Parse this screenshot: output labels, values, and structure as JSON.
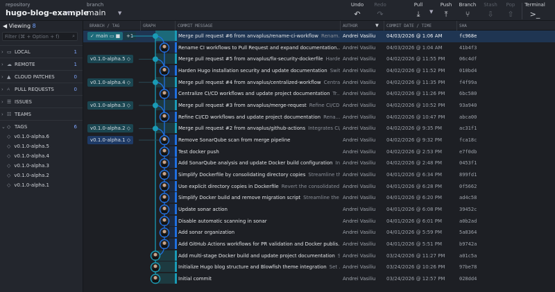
{
  "toolbar": {
    "repo_label": "repository",
    "repo": "hugo-blog-example",
    "branch_label": "branch",
    "branch": "main",
    "buttons": [
      {
        "label": "Undo",
        "icon": "↶"
      },
      {
        "label": "Redo",
        "icon": "↷"
      },
      {
        "label": "Pull",
        "icon": "⤓"
      },
      {
        "label": "Push",
        "icon": "⤒"
      },
      {
        "label": "Branch",
        "icon": "⑂"
      },
      {
        "label": "Stash",
        "icon": "⇩"
      },
      {
        "label": "Pop",
        "icon": "⇧"
      },
      {
        "label": "Terminal",
        "icon": ">_"
      }
    ]
  },
  "sidebar": {
    "viewing_label": "Viewing",
    "viewing_count": "8",
    "filter_placeholder": "Filter (⌘ + Option + f)",
    "sections": [
      {
        "label": "LOCAL",
        "count": "1",
        "icon": "▭"
      },
      {
        "label": "REMOTE",
        "count": "1",
        "icon": "☁"
      },
      {
        "label": "CLOUD PATCHES",
        "count": "0",
        "icon": "▲"
      },
      {
        "label": "PULL REQUESTS",
        "count": "0",
        "icon": "⑃"
      },
      {
        "label": "ISSUES",
        "count": "",
        "icon": "☰"
      },
      {
        "label": "TEAMS",
        "count": "",
        "icon": "☷"
      },
      {
        "label": "TAGS",
        "count": "6",
        "icon": "◇"
      }
    ],
    "tags": [
      "v0.1.0-alpha.6",
      "v0.1.0-alpha.5",
      "v0.1.0-alpha.4",
      "v0.1.0-alpha.3",
      "v0.1.0-alpha.2",
      "v0.1.0-alpha.1"
    ]
  },
  "columns": {
    "branch": "BRANCH / TAG",
    "graph": "GRAPH",
    "message": "COMMIT MESSAGE",
    "author": "AUTHOR",
    "date": "COMMIT DATE / TIME",
    "sha": "SHA"
  },
  "colors": {
    "teal": "#1a9bb5",
    "blue": "#1f6fe0",
    "selected": "#1f3552"
  },
  "commits": [
    {
      "msg": "Merge pull request #6 from anvaplus/rename-ci-workflow",
      "desc": "Renam...",
      "author": "Andrei Vasiliu",
      "date": "04/03/2026 @ 1:06 AM",
      "sha": "fc968e",
      "ref": "main",
      "ref_extra": "+1",
      "lane": "teal",
      "merge": true
    },
    {
      "msg": "Rename CI workflows to Pull Request and expand documentation...",
      "desc": "",
      "author": "Andrei Vasiliu",
      "date": "04/03/2026 @ 1:04 AM",
      "sha": "41b4f3",
      "lane": "blue"
    },
    {
      "msg": "Merge pull request #5 from anvaplus/fix-security-dockerfile",
      "desc": "Harde...",
      "author": "Andrei Vasiliu",
      "date": "04/02/2026 @ 11:55 PM",
      "sha": "06c4df",
      "ref": "v0.1.0-alpha.5",
      "lane": "teal",
      "merge": true
    },
    {
      "msg": "Harden Hugo installation security and update documentation",
      "desc": "Swit...",
      "author": "Andrei Vasiliu",
      "date": "04/02/2026 @ 11:52 PM",
      "sha": "010bd4",
      "lane": "blue"
    },
    {
      "msg": "Merge pull request #4 from anvaplus/centralized-workflow",
      "desc": "Centra...",
      "author": "Andrei Vasiliu",
      "date": "04/02/2026 @ 11:35 PM",
      "sha": "f4f99a",
      "ref": "v0.1.0-alpha.4",
      "lane": "teal",
      "merge": true
    },
    {
      "msg": "Centralize CI/CD workflows and update project documentation",
      "desc": "Tr...",
      "author": "Andrei Vasiliu",
      "date": "04/02/2026 @ 11:26 PM",
      "sha": "6bc580",
      "lane": "blue"
    },
    {
      "msg": "Merge pull request #3 from anvaplus/merge-request",
      "desc": "Refine CI/CD...",
      "author": "Andrei Vasiliu",
      "date": "04/02/2026 @ 10:52 PM",
      "sha": "93a940",
      "ref": "v0.1.0-alpha.3",
      "lane": "teal",
      "merge": true
    },
    {
      "msg": "Refine CI/CD workflows and update project documentation",
      "desc": "Rena...",
      "author": "Andrei Vasiliu",
      "date": "04/02/2026 @ 10:47 PM",
      "sha": "abca00",
      "lane": "blue"
    },
    {
      "msg": "Merge pull request #2 from anvaplus/github-actions",
      "desc": "Integrates CI/...",
      "author": "Andrei Vasiliu",
      "date": "04/02/2026 @ 9:35 PM",
      "sha": "ac31f1",
      "ref": "v0.1.0-alpha.2",
      "lane": "teal",
      "merge": true
    },
    {
      "msg": "Remove SonarQube scan from merge pipeline",
      "desc": "",
      "author": "Andrei Vasiliu",
      "date": "04/02/2026 @ 9:32 PM",
      "sha": "fca18c",
      "ref": "v0.1.0-alpha.1",
      "lane": "blue"
    },
    {
      "msg": "Test docker push",
      "desc": "",
      "author": "Andrei Vasiliu",
      "date": "04/02/2026 @ 2:53 PM",
      "sha": "e7f0db",
      "lane": "blue"
    },
    {
      "msg": "Add SonarQube analysis and update Docker build configuration",
      "desc": "In...",
      "author": "Andrei Vasiliu",
      "date": "04/02/2026 @ 2:48 PM",
      "sha": "0453f1",
      "lane": "blue"
    },
    {
      "msg": "Simplify Dockerfile by consolidating directory copies",
      "desc": "Streamline th...",
      "author": "Andrei Vasiliu",
      "date": "04/01/2026 @ 6:34 PM",
      "sha": "899fd1",
      "lane": "blue"
    },
    {
      "msg": "Use explicit directory copies in Dockerfile",
      "desc": "Revert the consolidated ...",
      "author": "Andrei Vasiliu",
      "date": "04/01/2026 @ 6:28 PM",
      "sha": "0f5662",
      "lane": "blue"
    },
    {
      "msg": "Simplify Docker build and remove migration script",
      "desc": "Streamline the ...",
      "author": "Andrei Vasiliu",
      "date": "04/01/2026 @ 6:20 PM",
      "sha": "ad4c58",
      "lane": "blue"
    },
    {
      "msg": "Update sonar action",
      "desc": "",
      "author": "Andrei Vasiliu",
      "date": "04/01/2026 @ 6:08 PM",
      "sha": "39452c",
      "lane": "blue"
    },
    {
      "msg": "Disable automatic scanning in sonar",
      "desc": "",
      "author": "Andrei Vasiliu",
      "date": "04/01/2026 @ 6:01 PM",
      "sha": "a0b2ad",
      "lane": "blue"
    },
    {
      "msg": "Add sonar organization",
      "desc": "",
      "author": "Andrei Vasiliu",
      "date": "04/01/2026 @ 5:59 PM",
      "sha": "5a8364",
      "lane": "blue"
    },
    {
      "msg": "Add GitHub Actions workflows for PR validation and Docker publis...",
      "desc": "",
      "author": "Andrei Vasiliu",
      "date": "04/01/2026 @ 5:51 PM",
      "sha": "b9742a",
      "lane": "blue"
    },
    {
      "msg": "Add multi-stage Docker build and update project documentation",
      "desc": "S...",
      "author": "Andrei Vasiliu",
      "date": "03/24/2026 @ 11:27 PM",
      "sha": "a01c5a",
      "lane": "teal"
    },
    {
      "msg": "Initialize Hugo blog structure and Blowfish theme integration",
      "desc": "Set ...",
      "author": "Andrei Vasiliu",
      "date": "03/24/2026 @ 10:26 PM",
      "sha": "97be78",
      "lane": "teal"
    },
    {
      "msg": "Initial commit",
      "desc": "",
      "author": "Andrei Vasiliu",
      "date": "03/24/2026 @ 12:57 PM",
      "sha": "028dd4",
      "lane": "teal"
    }
  ]
}
